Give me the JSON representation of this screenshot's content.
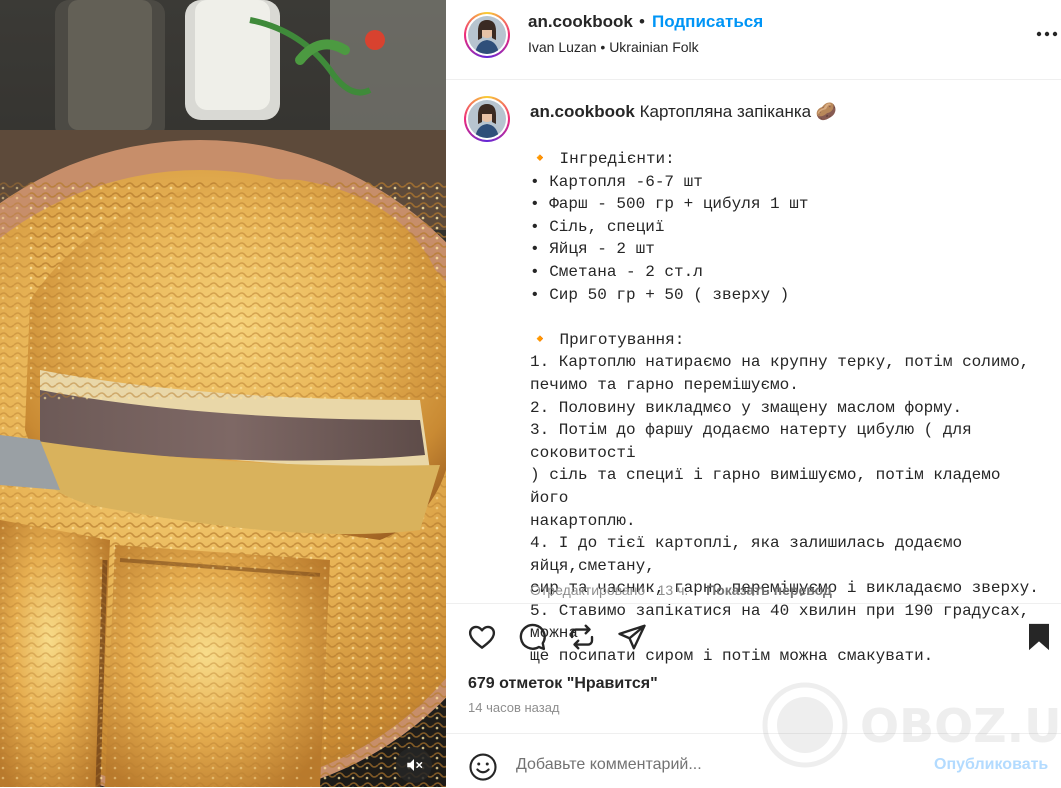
{
  "post": {
    "username": "an.cookbook",
    "dot": "•",
    "follow_label": "Подписаться",
    "audio_artist": "Ivan Luzan",
    "audio_track": "Ukrainian Folk"
  },
  "caption": {
    "username": "an.cookbook",
    "title": "Картопляна запіканка 🥔",
    "body": "🔸 Інгредієнти:\n• Картопля -6-7 шт\n• Фарш - 500 гр + цибуля 1 шт\n• Сіль, специї\n• Яйця - 2 шт\n• Сметана - 2 ст.л\n• Сир 50 гр + 50 ( зверху )\n\n🔸 Приготування:\n1. Картоплю натираємо на крупну терку, потім солимо,\nпечимо та гарно перемішуємо.\n2. Половину викладмєо у змащену маслом форму.\n3. Потім до фаршу додаємо натерту цибулю ( для соковитості\n) сіль та специї і гарно вимішуємо, потім кладемо його\nнакартоплю.\n4. І до тієї картоплі, яка залишилась додаємо яйця,сметану,\nсир та часник, гарно перемішуємо і викладаємо зверху.\n5. Ставимо запікатися на 40 хвилин при 190 градусах, можна\nще посипати сиром і потім можна смакувати.",
    "edited": "Отредактировано · 13 ч.",
    "translate": "Показать перевод"
  },
  "engagement": {
    "likes": "679 отметок \"Нравится\"",
    "time_ago": "14 часов назад"
  },
  "comment": {
    "placeholder": "Добавьте комментарий...",
    "post_label": "Опубликовать"
  },
  "watermark": {
    "text": "OBOZ.UA"
  },
  "icons": {
    "more": "more-horizontal-icon",
    "like": "heart-icon",
    "comment": "comment-icon",
    "repost": "repost-icon",
    "share": "share-icon",
    "save": "bookmark-icon",
    "emoji": "emoji-icon",
    "mute": "muted-speaker-icon"
  },
  "colors": {
    "accent": "#0095f6",
    "post_disabled": "#b3dbff",
    "secondary_text": "#8e8e8e"
  }
}
